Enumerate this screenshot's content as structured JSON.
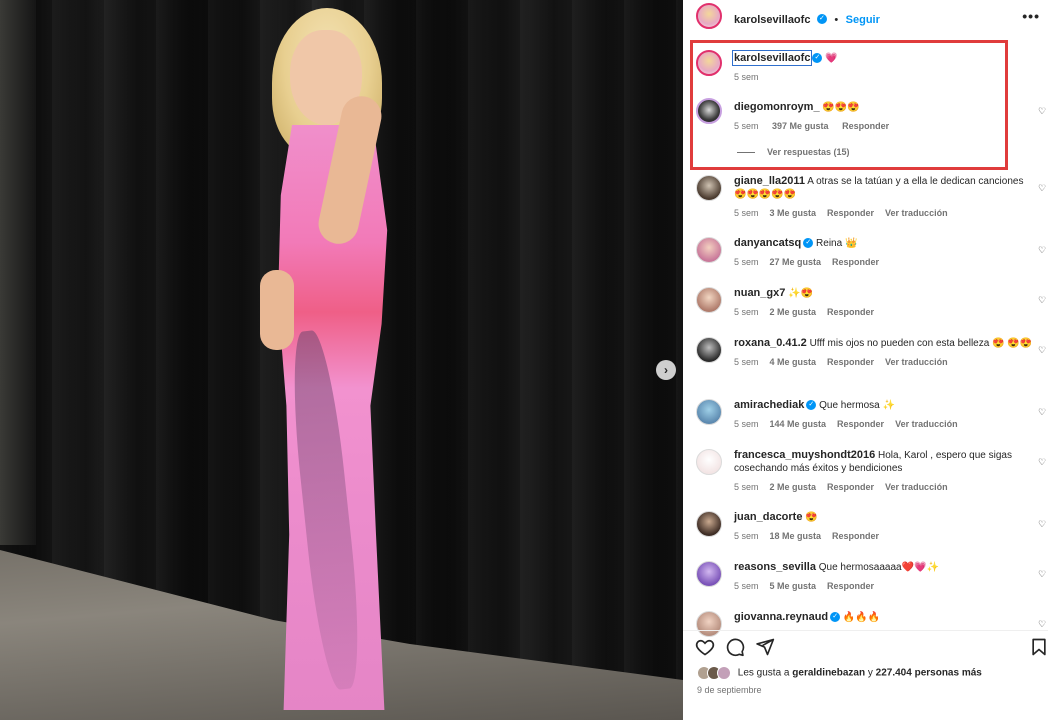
{
  "post": {
    "author": "karolsevillaofc",
    "follow_label": "Seguir",
    "more_label": "•••",
    "next_label": "›"
  },
  "caption": {
    "username": "karolsevillaofc",
    "text": "💗",
    "time": "5 sem"
  },
  "pinned": {
    "username": "diegomonroym_",
    "text": "😍😍😍",
    "time": "5 sem",
    "likes": "397 Me gusta",
    "reply": "Responder",
    "view_replies": "Ver respuestas (15)"
  },
  "comments": [
    {
      "username": "giane_lla2011",
      "text": "A otras se la tatúan y a ella le dedican canciones 😍😍😍😍😍",
      "time": "5 sem",
      "likes": "3 Me gusta",
      "reply": "Responder",
      "translate": "Ver traducción",
      "verified": false
    },
    {
      "username": "danyancatsq",
      "text": "Reina 👑",
      "time": "5 sem",
      "likes": "27 Me gusta",
      "reply": "Responder",
      "translate": "",
      "verified": true
    },
    {
      "username": "nuan_gx7",
      "text": "✨😍",
      "time": "5 sem",
      "likes": "2 Me gusta",
      "reply": "Responder",
      "translate": "",
      "verified": false
    },
    {
      "username": "roxana_0.41.2",
      "text": "Ufff mis ojos no pueden con esta belleza 😍 😍😍",
      "time": "5 sem",
      "likes": "4 Me gusta",
      "reply": "Responder",
      "translate": "Ver traducción",
      "verified": false
    },
    {
      "username": "amirachediak",
      "text": "Que hermosa ✨",
      "time": "5 sem",
      "likes": "144 Me gusta",
      "reply": "Responder",
      "translate": "Ver traducción",
      "verified": true
    },
    {
      "username": "francesca_muyshondt2016",
      "text": "Hola, Karol , espero que sigas cosechando más éxitos y bendiciones",
      "time": "5 sem",
      "likes": "2 Me gusta",
      "reply": "Responder",
      "translate": "Ver traducción",
      "verified": false
    },
    {
      "username": "juan_dacorte",
      "text": "😍",
      "time": "5 sem",
      "likes": "18 Me gusta",
      "reply": "Responder",
      "translate": "",
      "verified": false
    },
    {
      "username": "reasons_sevilla",
      "text": "Que hermosaaaaa❤️💗✨",
      "time": "5 sem",
      "likes": "5 Me gusta",
      "reply": "Responder",
      "translate": "",
      "verified": false
    },
    {
      "username": "giovanna.reynaud",
      "text": "🔥🔥🔥",
      "time": "",
      "likes": "",
      "reply": "",
      "translate": "",
      "verified": true
    }
  ],
  "footer": {
    "likes_prefix": "Les gusta a",
    "likes_user": "geraldinebazan",
    "likes_and": "y",
    "likes_count": "227.404 personas más",
    "date": "9 de septiembre"
  },
  "colors": {
    "accent": "#0095f6",
    "highlight": "#e03c3c",
    "muted": "#737373"
  }
}
